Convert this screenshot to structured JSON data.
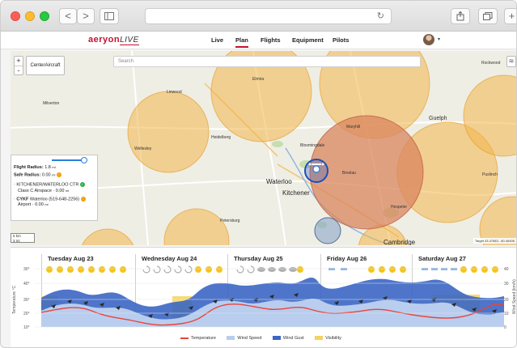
{
  "browser": {
    "nav_back": "<",
    "nav_forward": ">",
    "sidebar_icon": "sidebar-icon",
    "reload_icon": "reload-icon",
    "share_icon": "share-icon",
    "tabs_icon": "tabs-icon",
    "new_tab": "+"
  },
  "app": {
    "logo": "aeryon",
    "logo_suffix": "LIVE",
    "nav": [
      {
        "label": "Live",
        "active": false
      },
      {
        "label": "Plan",
        "active": true
      },
      {
        "label": "Flights",
        "active": false
      },
      {
        "label": "Equipment",
        "active": false
      },
      {
        "label": "Pilots",
        "active": false
      }
    ],
    "avatar_caret": "▾"
  },
  "map": {
    "zoom_in": "+",
    "zoom_out": "-",
    "center_button": "CenterAircraft",
    "search_placeholder": "Search",
    "labels": {
      "elmira": "Elmira",
      "guelph": "Guelph",
      "rockwood": "Rockwood",
      "milverton": "Milverton",
      "linwood": "Linwood",
      "heidelberg": "Heidelberg",
      "maryhill": "Maryhill",
      "bloomingdale": "Bloomingdale",
      "wellesley": "Wellesley",
      "waterloo": "Waterloo",
      "kitchener": "Kitchener",
      "breslau": "Breslau",
      "hespeler": "Hespeler",
      "puslinch": "Puslinch",
      "petersburg": "Petersburg",
      "cambridge": "Cambridge"
    },
    "info": {
      "flight_radius_label": "Flight Radius:",
      "flight_radius_value": "1.8",
      "flight_radius_unit": "mi",
      "safe_radius_label": "Safe Radius:",
      "safe_radius_value": "0.00",
      "safe_radius_unit": "mi",
      "airspace1_name": "KITCHENER/WATERLOO CTR",
      "airspace1_detail": "Class C Airspace · 0.00",
      "airspace1_unit": "mi",
      "airspace2_code": "CYKF",
      "airspace2_name": "Waterloo (519-648-2256)",
      "airspace2_detail": "Airport · 0.00",
      "airspace2_unit": "mi"
    },
    "scale_km": "5 km",
    "scale_mi": "3 mi",
    "target": "Target 43.47683, -80.46406",
    "colors": {
      "airspace_orange": "#f3b64c",
      "controlled_zone": "#d9865f",
      "flight_radius": "#2f6fd1"
    }
  },
  "forecast": {
    "days": [
      "Tuesday Aug 23",
      "Wednesday Aug 24",
      "Thursday Aug 25",
      "Friday Aug 26",
      "Saturday Aug 27"
    ],
    "left_axis_title": "Temperature °C",
    "right_axis_title": "Wind Speed (km/h)",
    "left_ticks": [
      "30°",
      "40°",
      "30°",
      "20°",
      "10°"
    ],
    "right_ticks": [
      "40",
      "30",
      "20",
      "10",
      "0"
    ],
    "legend": [
      {
        "label": "Temperature",
        "color": "#e8453c"
      },
      {
        "label": "Wind Speed",
        "color": "#b9cdee"
      },
      {
        "label": "Wind Gust",
        "color": "#3b66c4"
      },
      {
        "label": "Visibility",
        "color": "#f4d35e"
      }
    ]
  }
}
